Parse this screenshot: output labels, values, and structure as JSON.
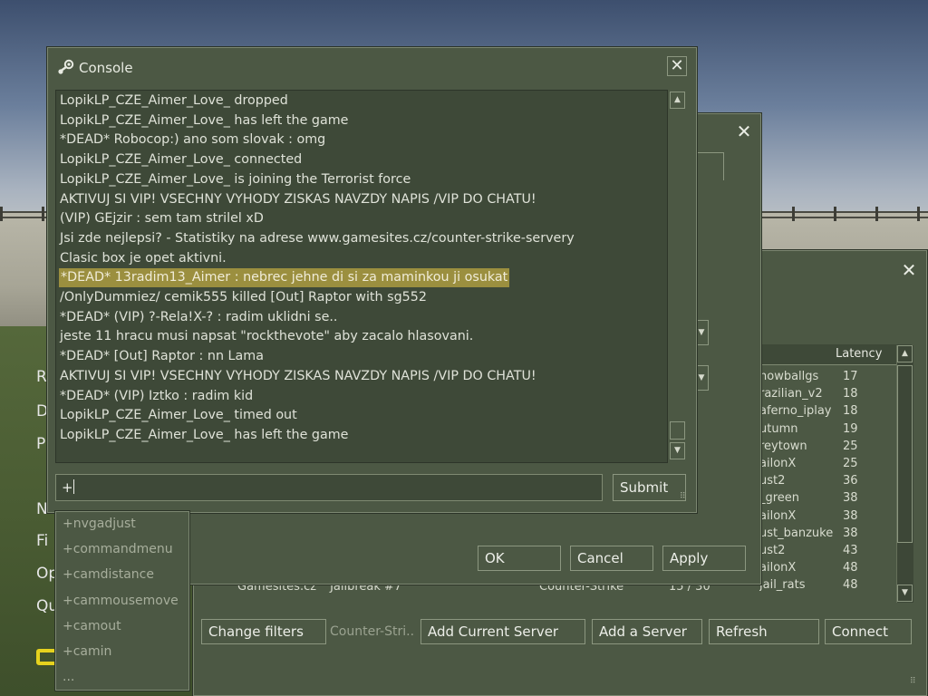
{
  "background_menu": {
    "items": [
      "R",
      "D",
      "P",
      "N",
      "Fi",
      "Op",
      "Qu"
    ]
  },
  "server_browser": {
    "columns": {
      "latency": "Latency"
    },
    "rows": [
      {
        "map": "nowballgs",
        "latency": "17"
      },
      {
        "map": "razilian_v2",
        "latency": "18"
      },
      {
        "map": "aferno_iplay",
        "latency": "18"
      },
      {
        "map": "utumn",
        "latency": "19"
      },
      {
        "map": "reytown",
        "latency": "25"
      },
      {
        "map": "ailonX",
        "latency": "25"
      },
      {
        "map": "ust2",
        "latency": "36"
      },
      {
        "map": "_green",
        "latency": "38"
      },
      {
        "map": "ailonX",
        "latency": "38"
      },
      {
        "map": "ust_banzuke",
        "latency": "38"
      },
      {
        "map": "ust2",
        "latency": "43"
      },
      {
        "map": "ailonX",
        "latency": "48"
      },
      {
        "map": "jail_rats",
        "latency": "48"
      }
    ],
    "partial_row": {
      "name": "Gamesites.cz ^Jailbreak #7",
      "game": "Counter-Strike",
      "players": "15 / 30"
    },
    "filter_text": "Counter-Stri..",
    "buttons": {
      "change_filters": "Change filters",
      "add_current": "Add Current Server",
      "add_server": "Add a Server",
      "refresh": "Refresh",
      "connect": "Connect"
    }
  },
  "options_dialog": {
    "ok": "OK",
    "cancel": "Cancel",
    "apply": "Apply"
  },
  "console": {
    "title": "Console",
    "lines": [
      "LopikLP_CZE_Aimer_Love_ dropped",
      "LopikLP_CZE_Aimer_Love_ has left the game",
      "*DEAD* Robocop:) ano som slovak : omg",
      "LopikLP_CZE_Aimer_Love_ connected",
      "LopikLP_CZE_Aimer_Love_ is joining the Terrorist force",
      "AKTIVUJ SI VIP! VSECHNY VYHODY ZISKAS NAVZDY NAPIS /VIP DO CHATU!",
      "(VIP) GEjzir : sem tam strilel xD",
      "Jsi zde nejlepsi? - Statistiky na adrese www.gamesites.cz/counter-strike-servery",
      "Clasic box je opet aktivni.",
      "*DEAD* 13radim13_Aimer : nebrec jehne di si za maminkou ji osukat",
      "/OnlyDummiez/ cemik555 killed [Out] Raptor with sg552",
      "*DEAD* (VIP) ?-Rela!X-? : radim uklidni se..",
      "jeste 11 hracu musi napsat \"rockthevote\" aby zacalo hlasovani.",
      "*DEAD* [Out] Raptor : nn Lama",
      "AKTIVUJ SI VIP! VSECHNY VYHODY ZISKAS NAVZDY NAPIS /VIP DO CHATU!",
      "*DEAD* (VIP) Iztko : radim kid",
      "LopikLP_CZE_Aimer_Love_ timed out",
      "LopikLP_CZE_Aimer_Love_ has left the game"
    ],
    "highlighted_line_index": 9,
    "input_value": "+",
    "submit_label": "Submit",
    "autocomplete": [
      "+nvgadjust",
      "+commandmenu",
      "+camdistance",
      "+cammousemove",
      "+camout",
      "+camin",
      "..."
    ]
  },
  "colors": {
    "panel": "#4c5844",
    "panel_dark": "#3e4938",
    "border": "#8c9780",
    "highlight": "#9b8f3f",
    "menu_yellow": "#e6d21e"
  },
  "icons": {
    "console_title": "steam-icon",
    "close": "close-icon",
    "scroll_up": "scroll-up-arrow-icon",
    "scroll_down": "scroll-down-arrow-icon",
    "dropdown": "dropdown-arrow-icon",
    "resize": "resize-grip-icon"
  }
}
